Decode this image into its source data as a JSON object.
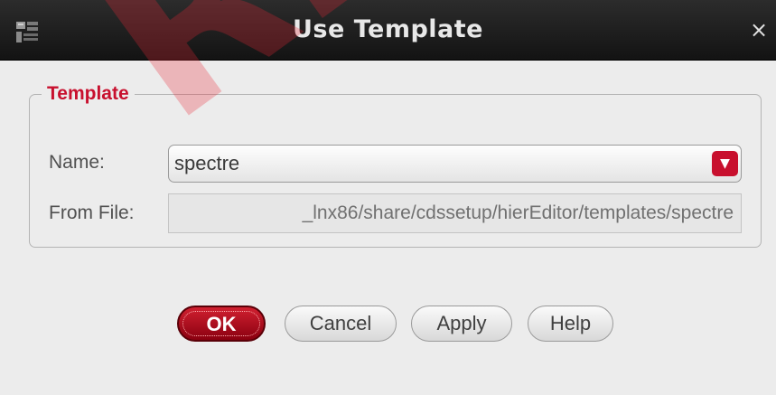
{
  "window": {
    "title": "Use Template",
    "app_icon": "hierarchy-editor-icon",
    "close_icon": "close-icon",
    "close_glyph": "×"
  },
  "template_group": {
    "title": "Template",
    "name_label": "Name:",
    "name_value": "spectre",
    "from_file_label": "From File:",
    "from_file_value": "_lnx86/share/cdssetup/hierEditor/templates/spectre"
  },
  "buttons": {
    "ok": "OK",
    "cancel": "Cancel",
    "apply": "Apply",
    "help": "Help"
  },
  "colors": {
    "accent": "#c8102e",
    "title_bar": "#1e1e1e",
    "dialog_background": "#ececec"
  },
  "watermark": "RiSL"
}
